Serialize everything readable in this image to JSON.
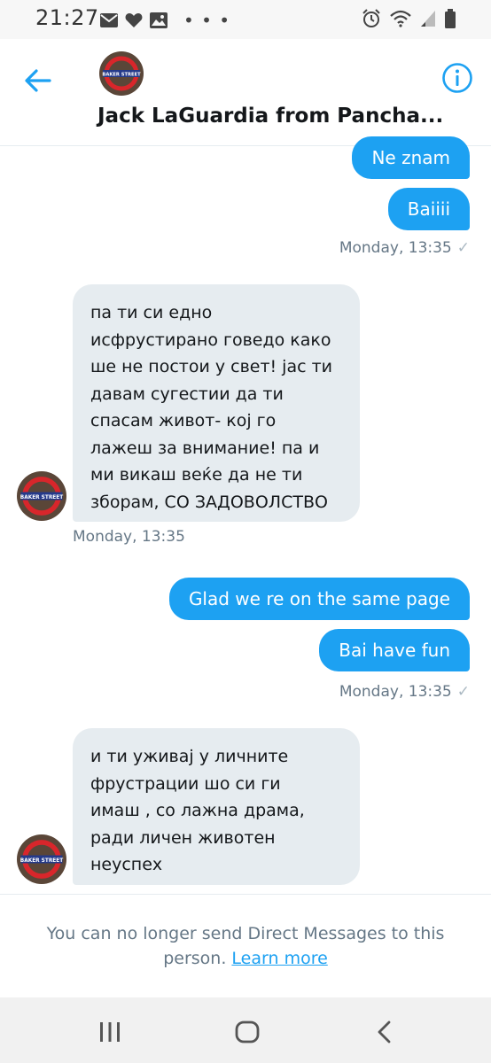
{
  "status_bar": {
    "time": "21:27",
    "icons_left": [
      "mail-icon",
      "heart-icon",
      "image-icon"
    ],
    "more": "• • •",
    "icons_right": [
      "alarm-icon",
      "wifi-icon",
      "signal-icon",
      "battery-icon"
    ]
  },
  "header": {
    "title": "Jack LaGuardia from Pancha...",
    "avatar_sign": "BAKER STREET",
    "back_icon": "back-arrow-icon",
    "info_icon": "info-icon"
  },
  "messages": {
    "out1": {
      "text": "Ne znam"
    },
    "out2": {
      "text": "Baiiii"
    },
    "ts1": "Monday, 13:35",
    "in1": {
      "lines": [
        "па ти си едно",
        "исфрустирано говедо како",
        "ше не постои у свет! јас ти",
        "давам сугестии да ти",
        "спасам живот- кој го",
        "лажеш за внимание! па и",
        "ми викаш веќе да не ти",
        "зборам, СО ЗАДОВОЛСТВО"
      ],
      "timestamp": "Monday, 13:35"
    },
    "out3": {
      "text": "Glad we re on the same page"
    },
    "out4": {
      "text": "Bai have fun"
    },
    "ts2": "Monday, 13:35",
    "in2": {
      "lines": [
        "и ти уживај у личните",
        "фрустрации шо си ги",
        "имаш , со лажна драма,",
        "ради личен животен",
        "неуспех"
      ]
    },
    "checkmark": "✓"
  },
  "footer": {
    "line1": "You can no longer send Direct Messages to this",
    "line2_prefix": "person. ",
    "link": "Learn more"
  },
  "navbar": {
    "items": [
      "recent-apps-icon",
      "home-icon",
      "back-icon"
    ]
  },
  "colors": {
    "accent": "#1da1f2",
    "incoming_bubble": "#e6ecf0",
    "muted_text": "#657786"
  }
}
